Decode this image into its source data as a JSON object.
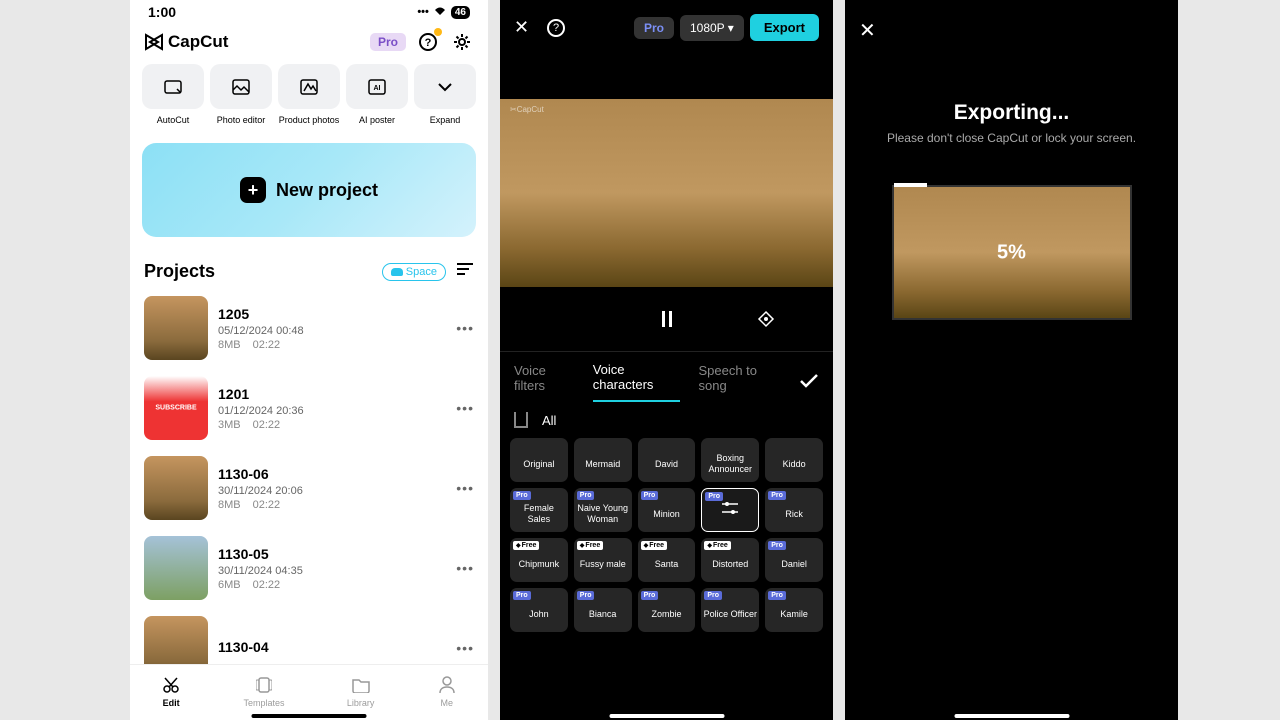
{
  "phone1": {
    "status": {
      "time": "1:00",
      "battery": "46"
    },
    "app_name": "CapCut",
    "pro_label": "Pro",
    "tools": [
      {
        "label": "AutoCut"
      },
      {
        "label": "Photo editor"
      },
      {
        "label": "Product photos"
      },
      {
        "label": "AI poster"
      },
      {
        "label": "Expand"
      }
    ],
    "new_project": "New project",
    "projects_title": "Projects",
    "space_label": "Space",
    "projects": [
      {
        "name": "1205",
        "date": "05/12/2024 00:48",
        "size": "8MB",
        "dur": "02:22",
        "thumb": "thumb1"
      },
      {
        "name": "1201",
        "date": "01/12/2024 20:36",
        "size": "3MB",
        "dur": "02:22",
        "thumb": "thumb2"
      },
      {
        "name": "1130-06",
        "date": "30/11/2024 20:06",
        "size": "8MB",
        "dur": "02:22",
        "thumb": "thumb1"
      },
      {
        "name": "1130-05",
        "date": "30/11/2024 04:35",
        "size": "6MB",
        "dur": "02:22",
        "thumb": "thumb3"
      },
      {
        "name": "1130-04",
        "date": "",
        "size": "",
        "dur": "",
        "thumb": "thumb1"
      }
    ],
    "nav": {
      "edit": "Edit",
      "templates": "Templates",
      "library": "Library",
      "me": "Me"
    }
  },
  "phone2": {
    "pro_label": "Pro",
    "resolution": "1080P ▾",
    "export": "Export",
    "watermark": "✂CapCut",
    "tabs": {
      "filters": "Voice filters",
      "characters": "Voice characters",
      "song": "Speech to song"
    },
    "filter_all": "All",
    "voices_row1": [
      {
        "name": "Original",
        "badge": ""
      },
      {
        "name": "Mermaid",
        "badge": ""
      },
      {
        "name": "David",
        "badge": ""
      },
      {
        "name": "Boxing Announcer",
        "badge": ""
      },
      {
        "name": "Kiddo",
        "badge": ""
      }
    ],
    "voices_row2": [
      {
        "name": "Female Sales",
        "badge": "pro"
      },
      {
        "name": "Naive Young Woman",
        "badge": "pro"
      },
      {
        "name": "Minion",
        "badge": "pro"
      },
      {
        "name": "",
        "badge": "pro",
        "selected": true
      },
      {
        "name": "Rick",
        "badge": "pro"
      }
    ],
    "voices_row3": [
      {
        "name": "Chipmunk",
        "badge": "free"
      },
      {
        "name": "Fussy male",
        "badge": "free"
      },
      {
        "name": "Santa",
        "badge": "free"
      },
      {
        "name": "Distorted",
        "badge": "free"
      },
      {
        "name": "Daniel",
        "badge": "pro"
      }
    ],
    "voices_row4": [
      {
        "name": "John",
        "badge": "pro"
      },
      {
        "name": "Bianca",
        "badge": "pro"
      },
      {
        "name": "Zombie",
        "badge": "pro"
      },
      {
        "name": "Police Officer",
        "badge": "pro"
      },
      {
        "name": "Kamile",
        "badge": "pro"
      }
    ]
  },
  "phone3": {
    "title": "Exporting...",
    "subtitle": "Please don't close CapCut or lock your screen.",
    "percent": "5%"
  }
}
